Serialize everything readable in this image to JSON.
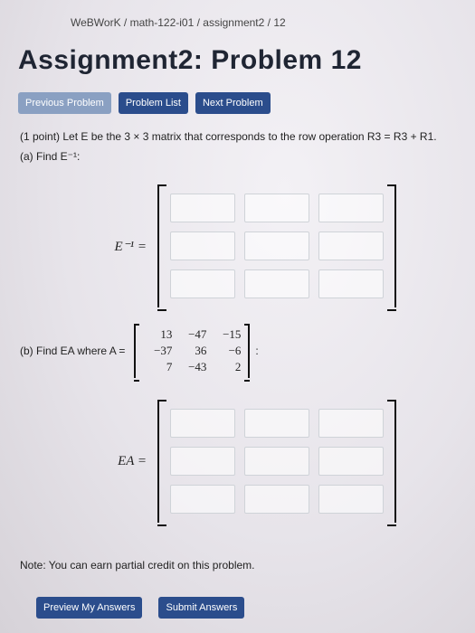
{
  "breadcrumb": "WeBWorK / math-122-i01 / assignment2 / 12",
  "title": "Assignment2: Problem 12",
  "nav": {
    "prev": "Previous Problem",
    "list": "Problem List",
    "next": "Next Problem"
  },
  "problem": {
    "intro": "(1 point) Let E be the 3 × 3 matrix that corresponds to the row operation R3 = R3 + R1.",
    "part_a": "(a) Find E⁻¹:",
    "einv_label": "E⁻¹ =",
    "part_b_prefix": "(b) Find EA where A =",
    "matrixA": [
      [
        "13",
        "−47",
        "−15"
      ],
      [
        "−37",
        "36",
        "−6"
      ],
      [
        "7",
        "−43",
        "2"
      ]
    ],
    "part_b_suffix": ":",
    "ea_label": "EA ="
  },
  "note": "Note: You can earn partial credit on this problem.",
  "buttons": {
    "preview": "Preview My Answers",
    "submit": "Submit Answers"
  }
}
